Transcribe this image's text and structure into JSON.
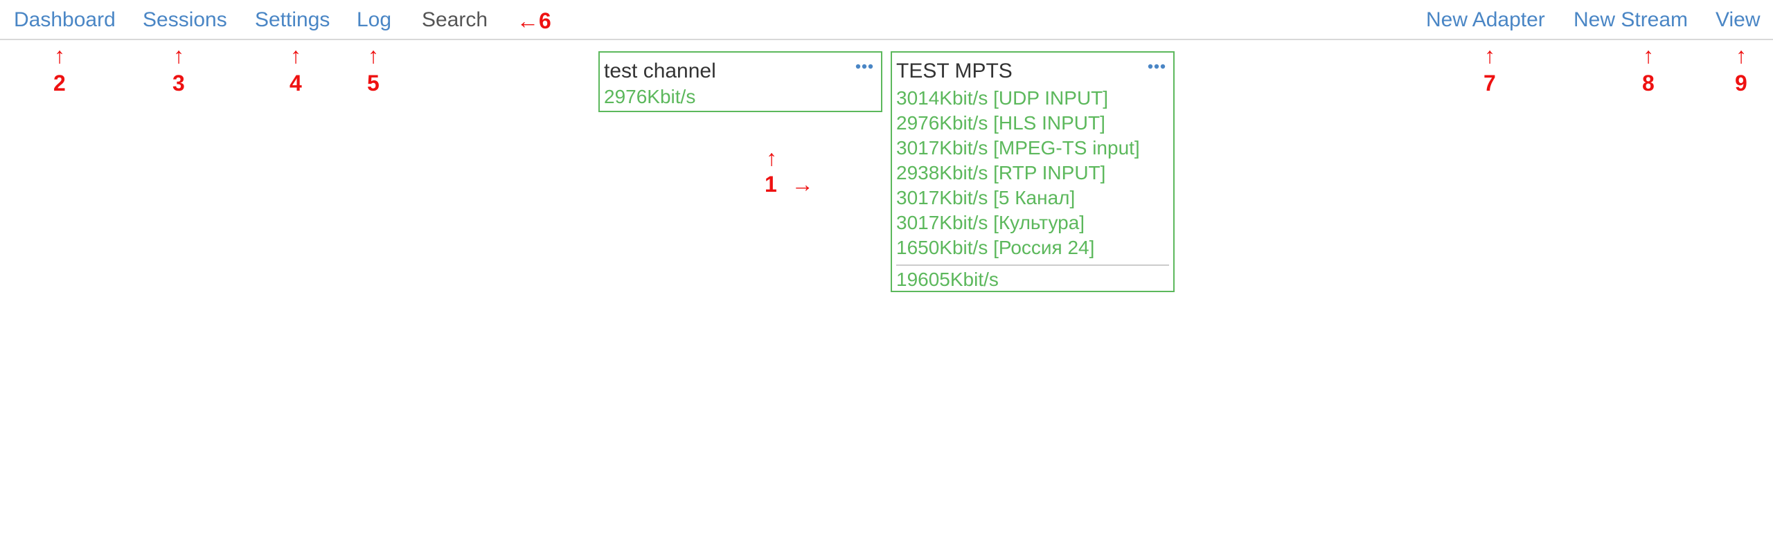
{
  "nav": {
    "left": [
      {
        "label": "Dashboard",
        "active": false
      },
      {
        "label": "Sessions",
        "active": false
      },
      {
        "label": "Settings",
        "active": false
      },
      {
        "label": "Log",
        "active": false
      },
      {
        "label": "Search",
        "active": true
      }
    ],
    "right": [
      {
        "label": "New Adapter"
      },
      {
        "label": "New Stream"
      },
      {
        "label": "View"
      }
    ]
  },
  "cards": [
    {
      "title": "test channel",
      "rows": [],
      "total": "2976Kbit/s"
    },
    {
      "title": "TEST MPTS",
      "rows": [
        "3014Kbit/s [UDP INPUT]",
        "2976Kbit/s [HLS INPUT]",
        "3017Kbit/s [MPEG-TS input]",
        "2938Kbit/s [RTP INPUT]",
        "3017Kbit/s [5 Канал]",
        "3017Kbit/s [Культура]",
        "1650Kbit/s [Россия 24]"
      ],
      "total": "19605Kbit/s"
    }
  ],
  "markers": {
    "m1": {
      "arrow_up": "↑",
      "num": "1",
      "arrow_right": "→"
    },
    "m2": {
      "arrow": "↑",
      "num": "2"
    },
    "m3": {
      "arrow": "↑",
      "num": "3"
    },
    "m4": {
      "arrow": "↑",
      "num": "4"
    },
    "m5": {
      "arrow": "↑",
      "num": "5"
    },
    "m6": {
      "arrow": "←",
      "num": "6"
    },
    "m7": {
      "arrow": "↑",
      "num": "7"
    },
    "m8": {
      "arrow": "↑",
      "num": "8"
    },
    "m9": {
      "arrow": "↑",
      "num": "9"
    }
  },
  "colors": {
    "link": "#4a86c5",
    "active_link": "#555555",
    "ok_green": "#5cb85c",
    "annotation_red": "#ee1111"
  }
}
